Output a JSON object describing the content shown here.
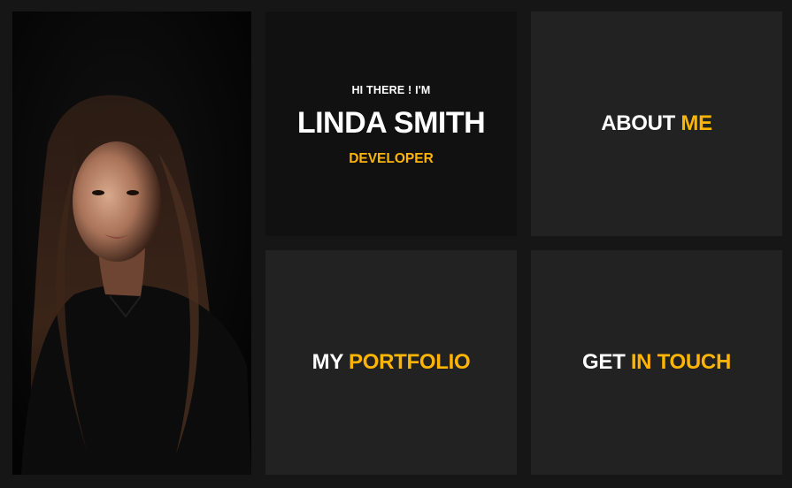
{
  "intro": {
    "greeting": "HI THERE ! I'M",
    "name": "LINDA SMITH",
    "role": "DEVELOPER"
  },
  "tiles": {
    "about": {
      "white": "ABOUT",
      "accent": "ME"
    },
    "portfolio": {
      "white": "MY",
      "accent": "PORTFOLIO"
    },
    "contact": {
      "white": "GET",
      "accent": "IN TOUCH"
    }
  },
  "colors": {
    "background": "#161616",
    "intro_panel": "#111111",
    "tile": "#222222",
    "accent": "#ffb400",
    "text": "#ffffff"
  }
}
